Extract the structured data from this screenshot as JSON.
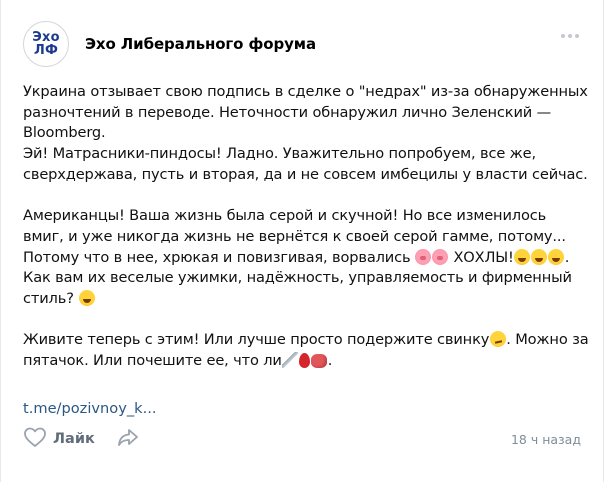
{
  "post": {
    "author": {
      "name": "Эхо Либерального форума",
      "avatar_line1": "Эхо",
      "avatar_line2": "ЛФ"
    },
    "paragraphs": {
      "p1": "Украина отзывает свою подпись в сделке о \"недрах\" из-за обнаруженных разночтений в переводе. Неточности обнаружил лично Зеленский — Bloomberg.",
      "p2": "Эй! Матрасники-пиндосы! Ладно. Уважительно попробуем, все же, сверхдержава, пусть и вторая, да и не совсем имбецилы у власти сейчас.",
      "p3a": "Американцы! Ваша жизнь была серой и скучной! Но все изменилось вмиг, и уже никогда жизнь не вернётся к своей серой гамме, потому... Потому что в нее, хрюкая и повизгивая, ворвались ",
      "p3b": " ХОХЛЫ!",
      "p3c": ". Как вам их веселые ужимки, надёжность, управляемость и фирменный стиль? ",
      "p4a": "Живите теперь с этим! Или лучше просто подержите свинку",
      "p4b": ". Можно за пятачок. Или почешите ее, что ли",
      "p4c": "."
    },
    "emoji": {
      "pig_face": "pig-face-emoji",
      "pig_face_2": "pig-face-emoji",
      "laugh": "tears-of-joy-emoji",
      "smirk": "smirking-face-emoji",
      "knife": "knife-emoji",
      "drop": "drop-of-blood-emoji",
      "meat": "meat-emoji"
    },
    "link": "t.me/pozivnoy_k...",
    "actions": {
      "like_label": "Лайк",
      "like_icon": "heart-outline-icon",
      "share_icon": "share-arrow-icon",
      "more_icon": "more-dots-icon"
    },
    "timestamp": "18 ч назад"
  },
  "colors": {
    "link": "#2a5885",
    "avatar_text": "#1d3a8f",
    "muted": "#818c99",
    "action": "#626d7a"
  }
}
